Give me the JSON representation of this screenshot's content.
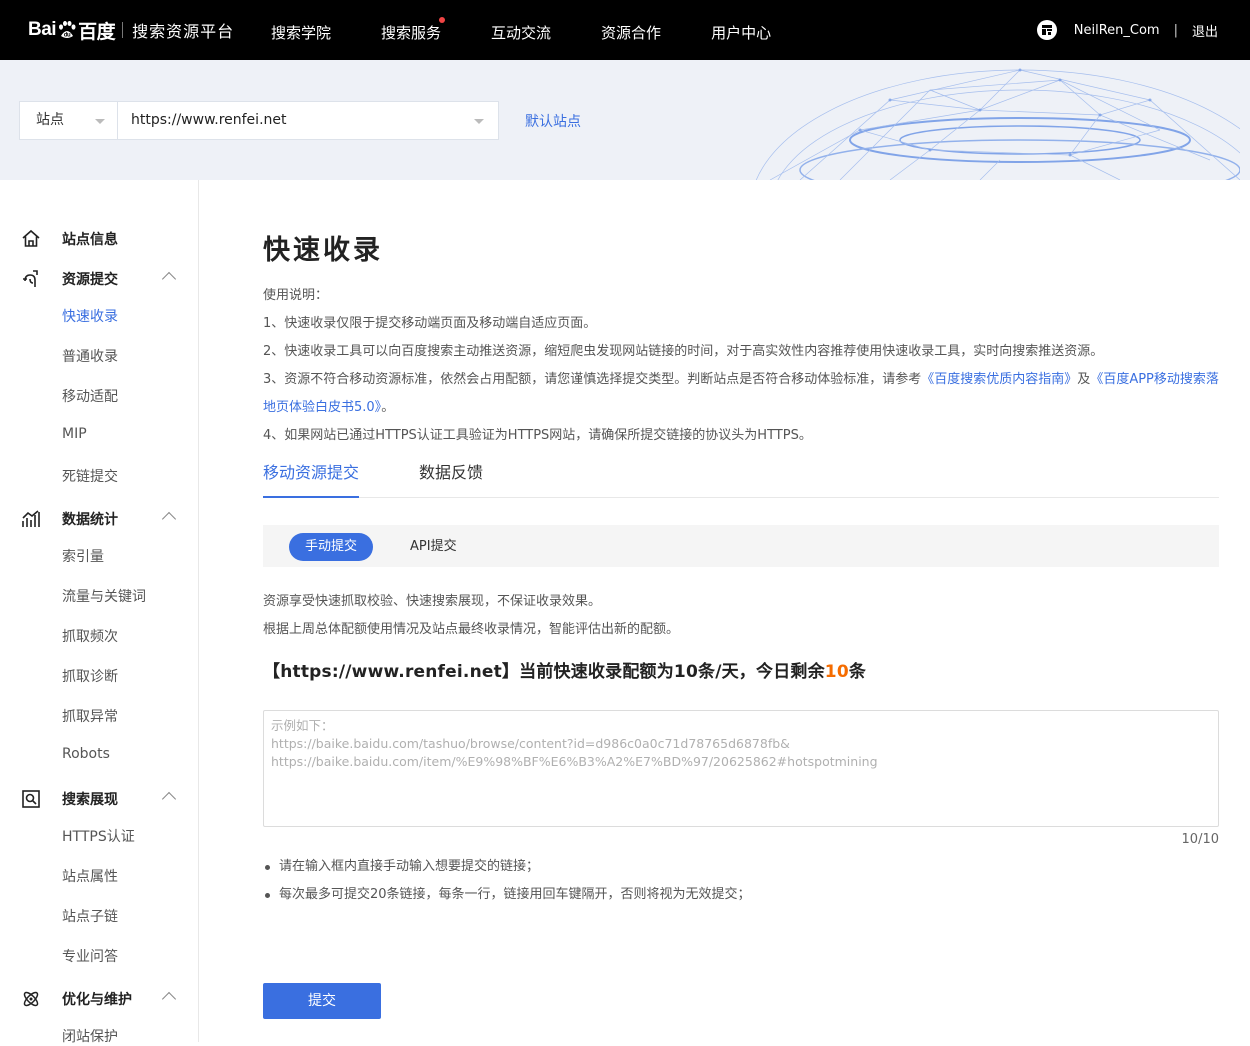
{
  "header": {
    "logo_mark": "Bai百度",
    "logo_text": "搜索资源平台",
    "nav": [
      {
        "label": "搜索学院"
      },
      {
        "label": "搜索服务",
        "dot": true
      },
      {
        "label": "互动交流"
      },
      {
        "label": "资源合作"
      },
      {
        "label": "用户中心"
      }
    ],
    "username": "NeilRen_Com",
    "separator": "|",
    "logout": "退出"
  },
  "sitebar": {
    "select_label": "站点",
    "site_url": "https://www.renfei.net",
    "default_site": "默认站点"
  },
  "sidebar": {
    "groups": [
      {
        "label": "站点信息",
        "icon": "home-icon",
        "items": []
      },
      {
        "label": "资源提交",
        "icon": "submit-resource-icon",
        "items": [
          "快速收录",
          "普通收录",
          "移动适配",
          "MIP",
          "死链提交"
        ]
      },
      {
        "label": "数据统计",
        "icon": "stats-icon",
        "items": [
          "索引量",
          "流量与关键词",
          "抓取频次",
          "抓取诊断",
          "抓取异常",
          "Robots"
        ]
      },
      {
        "label": "搜索展现",
        "icon": "search-display-icon",
        "items": [
          "HTTPS认证",
          "站点属性",
          "站点子链",
          "专业问答"
        ]
      },
      {
        "label": "优化与维护",
        "icon": "optimize-icon",
        "items": [
          "闭站保护"
        ]
      }
    ],
    "active_item": "快速收录"
  },
  "main": {
    "title": "快速收录",
    "instructions": {
      "heading": "使用说明：",
      "line1": "1、快速收录仅限于提交移动端页面及移动端自适应页面。",
      "line2": "2、快速收录工具可以向百度搜索主动推送资源，缩短爬虫发现网站链接的时间，对于高实效性内容推荐使用快速收录工具，实时向搜索推送资源。",
      "line3_pre": "3、资源不符合移动资源标准，依然会占用配额，请您谨慎选择提交类型。判断站点是否符合移动体验标准，请参考",
      "line3_link1": "《百度搜索优质内容指南》",
      "line3_mid": "及",
      "line3_link2": "《百度APP移动搜索落地页体验白皮书5.0》",
      "line3_post": "。",
      "line4": "4、如果网站已通过HTTPS认证工具验证为HTTPS网站，请确保所提交链接的协议头为HTTPS。"
    },
    "tabs": [
      "移动资源提交",
      "数据反馈"
    ],
    "subtabs": [
      "手动提交",
      "API提交"
    ],
    "desc1": "资源享受快速抓取校验、快速搜索展现，不保证收录效果。",
    "desc2": "根据上周总体配额使用情况及站点最终收录情况，智能评估出新的配额。",
    "quota_pre": "【https://www.renfei.net】当前快速收录配额为10条/天，今日剩余",
    "quota_remaining": "10",
    "quota_post": "条",
    "textarea_placeholder": "示例如下：\nhttps://baike.baidu.com/tashuo/browse/content?id=d986c0a0c71d78765d6878fb&\nhttps://baike.baidu.com/item/%E9%98%BF%E6%B3%A2%E7%BD%97/20625862#hotspotmining",
    "counter": "10/10",
    "tips": [
      "请在输入框内直接手动输入想要提交的链接；",
      "每次最多可提交20条链接，每条一行，链接用回车键隔开，否则将视为无效提交；"
    ],
    "submit": "提交"
  },
  "colors": {
    "accent": "#3a6fe0",
    "highlight": "#f56c00",
    "topbar": "#000000"
  }
}
